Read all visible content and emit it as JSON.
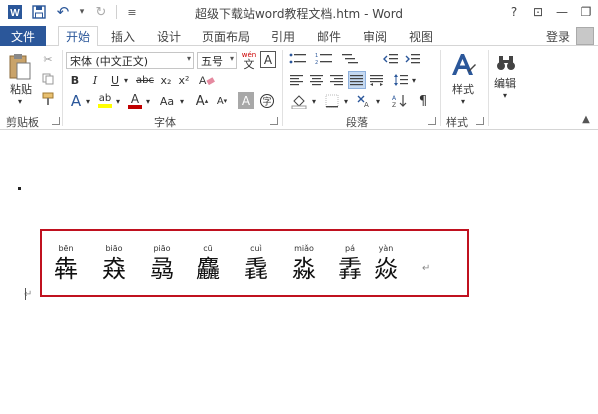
{
  "window": {
    "title": "超级下载站word教程文档.htm - Word",
    "help": "?",
    "ribbon_display": "⊡",
    "minimize": "—",
    "restore": "❐"
  },
  "qat": {
    "undo_icon": "↶",
    "undo_more": "▾",
    "redo_icon": "↻",
    "customize": "≡"
  },
  "tabs": {
    "file": "文件",
    "items": [
      "开始",
      "插入",
      "设计",
      "页面布局",
      "引用",
      "邮件",
      "审阅",
      "视图"
    ],
    "active": "开始",
    "login": "登录"
  },
  "ribbon": {
    "clipboard": {
      "paste": "粘贴",
      "label": "剪贴板"
    },
    "font": {
      "name": "宋体 (中文正文)",
      "size": "五号",
      "wen": "wén",
      "wen_char": "文",
      "label": "字体",
      "bold": "B",
      "italic": "I",
      "underline": "U",
      "strike": "abc",
      "sub": "x₂",
      "sup": "x²",
      "case": "Aa",
      "grow": "A",
      "shrink": "A",
      "effects": "A",
      "highlight": "ab",
      "color": "A",
      "char_shade": "A",
      "char_border": "A",
      "clear": "A"
    },
    "paragraph": {
      "label": "段落"
    },
    "styles": {
      "button": "样式",
      "label": "样式"
    },
    "editing": {
      "button": "编辑"
    }
  },
  "document": {
    "chars": [
      {
        "pinyin": "bēn",
        "hanzi": "犇"
      },
      {
        "pinyin": "biāo",
        "hanzi": "猋"
      },
      {
        "pinyin": "piāo",
        "hanzi": "骉"
      },
      {
        "pinyin": "cū",
        "hanzi": "麤"
      },
      {
        "pinyin": "cuì",
        "hanzi": "毳"
      },
      {
        "pinyin": "miǎo",
        "hanzi": "淼"
      },
      {
        "pinyin": "pá",
        "hanzi": "掱"
      },
      {
        "pinyin": "yàn",
        "hanzi": "焱"
      }
    ],
    "para_mark": "↵"
  },
  "colors": {
    "accent": "#2b579a",
    "highlight_box": "#c0111f",
    "font_color_red": "#c00000",
    "highlight_yellow": "#ffff00"
  }
}
